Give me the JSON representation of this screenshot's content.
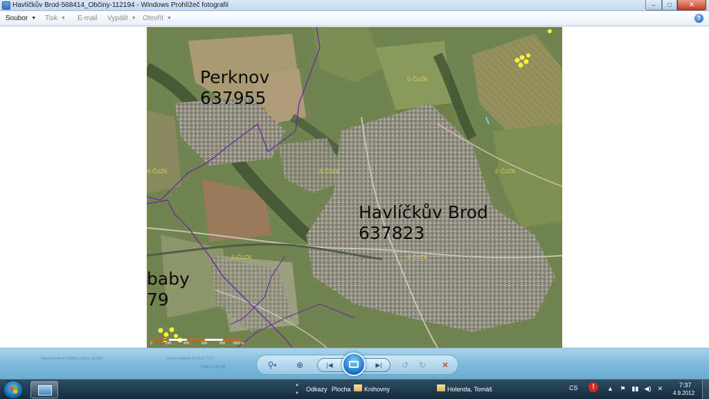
{
  "window": {
    "title": "Havlíčkův Brod-568414_Občiny-112194 - Windows Prohlížeč fotografií",
    "buttons": {
      "minimize": "–",
      "maximize": "□",
      "close": "✕"
    }
  },
  "menubar": {
    "items": [
      {
        "label": "Soubor",
        "arrow": "▼",
        "enabled": true
      },
      {
        "label": "Tisk",
        "arrow": "▼",
        "enabled": false
      },
      {
        "label": "E-mail",
        "arrow": "",
        "enabled": false
      },
      {
        "label": "Vypálit",
        "arrow": "▼",
        "enabled": false
      },
      {
        "label": "Otevřít",
        "arrow": "▼",
        "enabled": false
      }
    ],
    "help": "?"
  },
  "map": {
    "labels": [
      {
        "line1": "Perknov",
        "line2": "637955"
      },
      {
        "line1": "Havlíčkův Brod",
        "line2": "637823"
      },
      {
        "line1": "baby",
        "line2": "79"
      }
    ],
    "watermark": "© ČUZK",
    "scalebar": [
      "0",
      "200",
      "400",
      "600",
      "800",
      "1000 m"
    ]
  },
  "controls": {
    "zoom_icon": "⚲",
    "zoom_arrow": "▾",
    "fit_icon": "⊕",
    "prev_icon": "|◀",
    "next_icon": "▶|",
    "rotate_ccw_icon": "↺",
    "rotate_cw_icon": "↻",
    "delete_icon": "✕",
    "ghost_filename": "Havlíčkův Brod-568414_Občiny-112194",
    "ghost_date": "Datum pořízení: 4.9.2012 7:37",
    "ghost_size": "Velikost: 283 kB"
  },
  "taskbar": {
    "links": {
      "odkazy": "Odkazy",
      "plocha": "Plocha",
      "knihovny": "Knihovny"
    },
    "user": "Holenda, Tomáš",
    "language": "CS",
    "time": "7:37",
    "date": "4.9.2012",
    "scroll_up": "▲",
    "scroll_down": "▼",
    "alert": "!",
    "tray_icons": [
      "▲",
      "⚑",
      "▮▮",
      "◀)",
      "✕"
    ]
  },
  "colors": {
    "title_bar": "#c3d8ef",
    "control_bar": "#7bb7d8",
    "taskbar": "#162b3c",
    "boundary": "#6a2f9a",
    "watermark": "#d9d25a",
    "marker": "#f5f23a"
  }
}
